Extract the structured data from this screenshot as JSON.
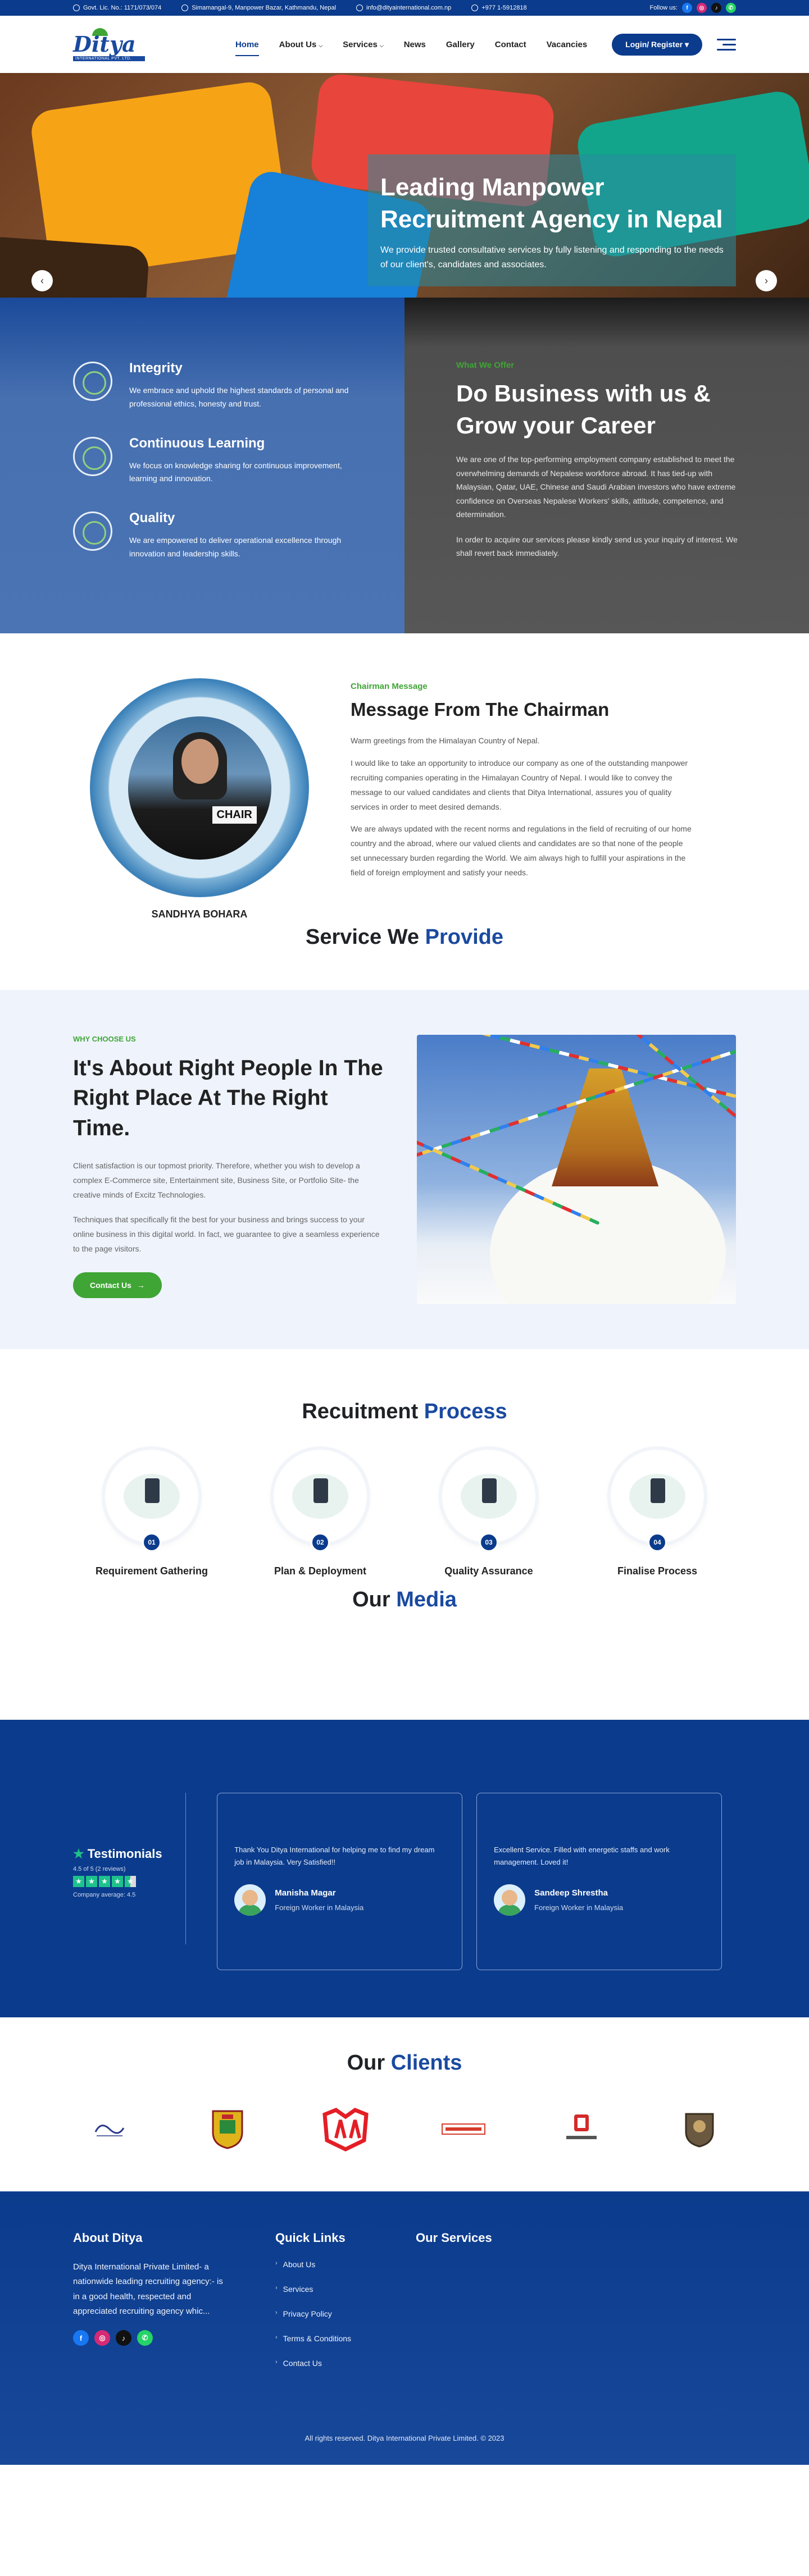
{
  "topbar": {
    "gov_lic": "Govt. Lic. No.: 1171/073/074",
    "address": "Simamangal-9, Manpower Bazar, Kathmandu, Nepal",
    "email": "info@dityainternational.com.np",
    "phone": "+977 1-5912818",
    "follow_label": "Follow us:"
  },
  "logo": {
    "name": "Ditya",
    "sub": "INTERNATIONAL PVT. LTD."
  },
  "nav": {
    "items": [
      {
        "label": "Home",
        "active": true,
        "dropdown": false
      },
      {
        "label": "About Us",
        "active": false,
        "dropdown": true
      },
      {
        "label": "Services",
        "active": false,
        "dropdown": true
      },
      {
        "label": "News",
        "active": false,
        "dropdown": false
      },
      {
        "label": "Gallery",
        "active": false,
        "dropdown": false
      },
      {
        "label": "Contact",
        "active": false,
        "dropdown": false
      },
      {
        "label": "Vacancies",
        "active": false,
        "dropdown": false
      }
    ],
    "login_label": "Login/ Register"
  },
  "hero": {
    "title": "Leading Manpower Recruitment Agency in Nepal",
    "text": "We provide trusted consultative services by fully listening and responding to the needs of our client's, candidates and associates."
  },
  "values": [
    {
      "title": "Integrity",
      "text": "We embrace and uphold the highest standards of personal and professional ethics, honesty and trust."
    },
    {
      "title": "Continuous Learning",
      "text": "We focus on knowledge sharing for continuous improvement, learning and innovation."
    },
    {
      "title": "Quality",
      "text": "We are empowered to deliver operational excellence through innovation and leadership skills."
    }
  ],
  "business": {
    "eyebrow": "What We Offer",
    "title": "Do Business with us & Grow your Career",
    "para1": "We are one of the top-performing employment company established to meet the overwhelming demands of Nepalese workforce abroad. It has tied-up with Malaysian, Qatar, UAE, Chinese and Saudi Arabian investors who have extreme confidence on Overseas Nepalese Workers' skills, attitude, competence, and determination.",
    "para2": "In order to acquire our services please kindly send us your inquiry of interest. We shall revert back immediately."
  },
  "chairman": {
    "eyebrow": "Chairman Message",
    "title": "Message From The Chairman",
    "plate": "CHAIR",
    "name": "SANDHYA BOHARA",
    "greeting": "Warm greetings from the Himalayan Country of Nepal.",
    "para1": "I would like to take an opportunity to introduce our company as one of the outstanding manpower recruiting companies operating in the Himalayan Country of Nepal. I would like to convey the message to our valued candidates and clients that Ditya International, assures you of quality services in order to meet desired demands.",
    "para2": "We are always updated with the recent norms and regulations in the field of recruiting of our home country and the abroad, where our valued clients and candidates are so that none of the people set unnecessary burden regarding the World. We aim always high to fulfill your aspirations in the field of foreign employment and satisfy your needs."
  },
  "services_title": {
    "pre": "Service We ",
    "hl": "Provide"
  },
  "why": {
    "eyebrow": "WHY CHOOSE US",
    "title": "It's About Right People In The Right Place At The Right Time.",
    "para1": "Client satisfaction is our topmost priority. Therefore, whether you wish to develop a complex E-Commerce site, Entertainment site, Business Site, or Portfolio Site- the creative minds of Excitz Technologies.",
    "para2": "Techniques that specifically fit the best for your business and brings success to your online business in this digital world. In fact, we guarantee to give a seamless experience to the page visitors.",
    "button": "Contact Us"
  },
  "process": {
    "title_pre": "Recuitment ",
    "title_hl": "Process",
    "steps": [
      {
        "num": "01",
        "label": "Requirement Gathering"
      },
      {
        "num": "02",
        "label": "Plan & Deployment"
      },
      {
        "num": "03",
        "label": "Quality Assurance"
      },
      {
        "num": "04",
        "label": "Finalise Process"
      }
    ]
  },
  "media_title": {
    "pre": "Our ",
    "hl": "Media"
  },
  "testimonials": {
    "heading": "Testimonials",
    "rating_text": "4.5 of 5 (2 reviews)",
    "average": "Company average: 4.5",
    "rating": 4.5,
    "items": [
      {
        "text": "Thank You Ditya International for helping me to find my dream job in Malaysia. Very Satisfied!!",
        "name": "Manisha Magar",
        "role": "Foreign Worker in Malaysia"
      },
      {
        "text": "Excellent Service. Filled with energetic staffs and work management. Loved it!",
        "name": "Sandeep Shrestha",
        "role": "Foreign Worker in Malaysia"
      }
    ]
  },
  "clients_title": {
    "pre": "Our ",
    "hl": "Clients"
  },
  "footer": {
    "about_title": "About Ditya",
    "about_text": "Ditya International Private Limited- a nationwide leading recruiting agency:- is in a good health, respected and appreciated recruiting agency whic...",
    "links_title": "Quick Links",
    "links": [
      "About Us",
      "Services",
      "Privacy Policy",
      "Terms & Conditions",
      "Contact Us"
    ],
    "services_title": "Our Services",
    "copyright": "All rights reserved. Ditya International Private Limited. © 2023"
  },
  "colors": {
    "brand_blue": "#0b3b8c",
    "accent_green": "#3fa535",
    "star_green": "#1ec28b"
  }
}
